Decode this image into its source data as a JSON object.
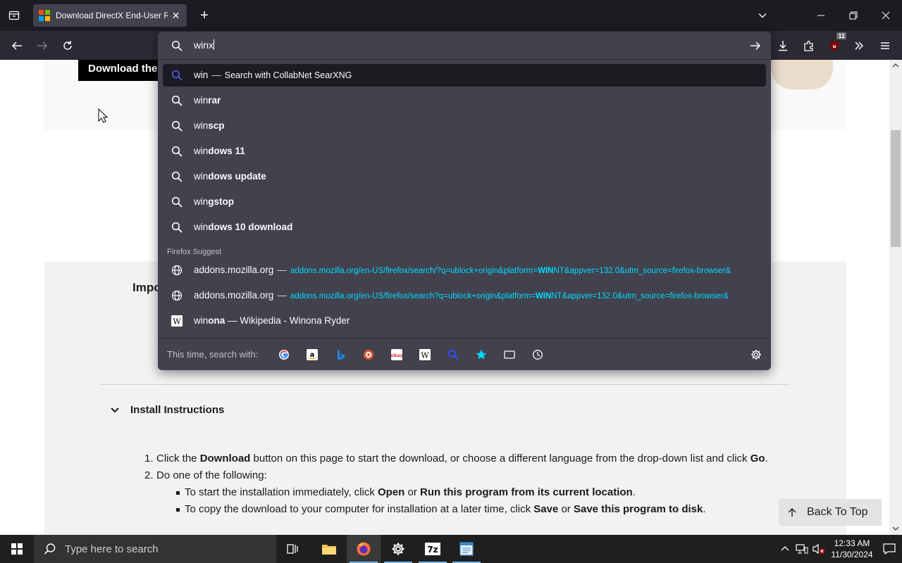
{
  "browser": {
    "tab": {
      "title": "Download DirectX End-User Runtime"
    },
    "urlbar": {
      "value": "winx"
    }
  },
  "suggestions": [
    {
      "icon": "search-icon",
      "typed": "win",
      "completion": "",
      "action": "Search with CollabNet SearXNG",
      "selected": true
    },
    {
      "icon": "search-icon",
      "typed": "win",
      "completion": "rar"
    },
    {
      "icon": "search-icon",
      "typed": "win",
      "completion": "scp"
    },
    {
      "icon": "search-icon",
      "typed": "win",
      "completion": "dows 11"
    },
    {
      "icon": "search-icon",
      "typed": "win",
      "completion": "dows update"
    },
    {
      "icon": "search-icon",
      "typed": "win",
      "completion": "gstop"
    },
    {
      "icon": "search-icon",
      "typed": "win",
      "completion": "dows 10 download"
    }
  ],
  "firefox_suggest": {
    "label": "Firefox Suggest",
    "items": [
      {
        "icon": "globe-icon",
        "title": "addons.mozilla.org",
        "url_pre": "addons.mozilla.org/en-US/firefox/search/?q=ublock+origin&platform=",
        "url_bold": "WIN",
        "url_post": "NT&appver=132.0&utm_source=firefox-browser&"
      },
      {
        "icon": "globe-icon",
        "title": "addons.mozilla.org",
        "url_pre": "addons.mozilla.org/en-US/firefox/search?q=ublock+origin&platform=",
        "url_bold": "WIN",
        "url_post": "NT&appver=132.0&utm_source=firefox-browser&"
      },
      {
        "icon": "wikipedia-icon",
        "typed": "win",
        "completion": "ona",
        "rest": "— Wikipedia - Winona Ryder"
      }
    ]
  },
  "footer": {
    "label": "This time, search with:"
  },
  "page": {
    "download_button": "Download the",
    "important_heading": "Impo",
    "install_title": "Install Instructions",
    "step1": {
      "num": "1.",
      "a": "Click the ",
      "b": "Download",
      "c": " button on this page to start the download, or choose a different language from the drop-down list and click ",
      "d": "Go",
      "e": "."
    },
    "step2": {
      "num": "2.",
      "text": "Do one of the following:"
    },
    "bullet1": {
      "a": "To start the installation immediately, click ",
      "b": "Open",
      "c": " or ",
      "d": "Run this program from its current location",
      "e": "."
    },
    "bullet2": {
      "a": "To copy the download to your computer for installation at a later time, click ",
      "b": "Save",
      "c": " or ",
      "d": "Save this program to disk",
      "e": "."
    },
    "back_to_top": "Back To Top"
  },
  "taskbar": {
    "search_placeholder": "Type here to search",
    "time": "12:33 AM",
    "date": "11/30/2024"
  },
  "extension_badge": "11",
  "colors": {
    "accent_cyan": "#00ddff",
    "search_blue": "#4c5ee8",
    "panel": "#42414d",
    "toolbar": "#2b2a33"
  }
}
